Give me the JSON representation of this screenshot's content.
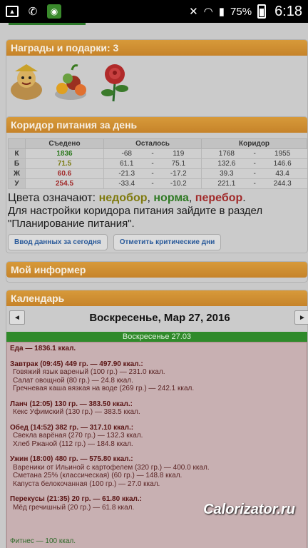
{
  "status": {
    "battery_pct": "75%",
    "time": "6:18"
  },
  "awards": {
    "title": "Награды и подарки: 3"
  },
  "corridor": {
    "title": "Коридор питания за день",
    "headers": [
      "Съедено",
      "Осталось",
      "Коридор"
    ],
    "rows": [
      {
        "label": "К",
        "eaten": "1836",
        "eaten_color": "#2e7a20",
        "left_min": "-68",
        "left_max": "119",
        "corr_min": "1768",
        "corr_max": "1955"
      },
      {
        "label": "Б",
        "eaten": "71.5",
        "eaten_color": "#7a7a10",
        "left_min": "61.1",
        "left_max": "75.1",
        "corr_min": "132.6",
        "corr_max": "146.6"
      },
      {
        "label": "Ж",
        "eaten": "60.6",
        "eaten_color": "#a12a2a",
        "left_min": "-21.3",
        "left_max": "-17.2",
        "corr_min": "39.3",
        "corr_max": "43.4"
      },
      {
        "label": "У",
        "eaten": "254.5",
        "eaten_color": "#a12a2a",
        "left_min": "-33.4",
        "left_max": "-10.2",
        "corr_min": "221.1",
        "corr_max": "244.3"
      }
    ],
    "dash": "-",
    "legend_prefix": "Цвета означают:",
    "legend_under": "недобор",
    "legend_norm": "норма",
    "legend_over": "перебор",
    "note": "Для настройки коридора питания зайдите в раздел \"Планирование питания\".",
    "btn_enter": "Ввод данных за сегодня",
    "btn_critical": "Отметить критические дни"
  },
  "informer": {
    "title": "Мой информер"
  },
  "calendar": {
    "title": "Календарь",
    "date": "Воскресенье, Мар 27, 2016",
    "prev": "◄",
    "next": "►",
    "day_label": "Воскресенье 27.03",
    "food_total": "Еда — 1836.1 ккал.",
    "meals": [
      {
        "title": "Завтрак (09:45) 449 гр. — 497.90 ккал.:",
        "items": [
          "Говяжий язык вареный (100 гр.) — 231.0 ккал.",
          "Салат овощной (80 гр.) — 24.8 ккал.",
          "Гречневая каша вязкая на воде (269 гр.) — 242.1 ккал."
        ]
      },
      {
        "title": "Ланч (12:05) 130 гр. — 383.50 ккал.:",
        "items": [
          "Кекс Уфимский (130 гр.) — 383.5 ккал."
        ]
      },
      {
        "title": "Обед (14:52) 382 гр. — 317.10 ккал.:",
        "items": [
          "Свекла варёная (270 гр.) — 132.3 ккал.",
          "Хлеб Ржаной (112 гр.) — 184.8 ккал."
        ]
      },
      {
        "title": "Ужин (18:00) 480 гр. — 575.80 ккал.:",
        "items": [
          "Вареники от Ильиной с картофелем (320 гр.) — 400.0 ккал.",
          "Сметана 25% (классическая) (60 гр.) — 148.8 ккал.",
          "Капуста белокочанная (100 гр.) — 27.0 ккал."
        ]
      },
      {
        "title": "Перекусы (21:35) 20 гр. — 61.80 ккал.:",
        "items": [
          "Мёд гречишный (20 гр.) — 61.8 ккал."
        ]
      }
    ],
    "fitness": "Фитнес — 100 ккал."
  },
  "watermark": "Calorizator.ru"
}
